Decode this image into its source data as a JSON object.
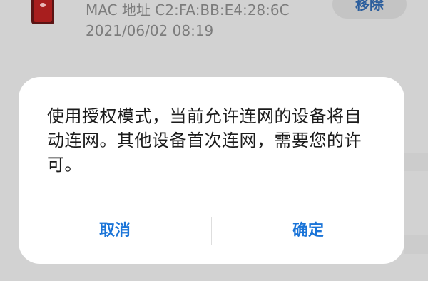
{
  "background": {
    "device_item": {
      "icon": "huawei-phone-icon",
      "mac_line": "MAC 地址 C2:FA:BB:E4:28:6C",
      "time_line": "2021/06/02 08:19",
      "remove_button": "移除"
    }
  },
  "dialog": {
    "message": "使用授权模式，当前允许连网的设备将自动连网。其他设备首次连网，需要您的许可。",
    "cancel_label": "取消",
    "confirm_label": "确定"
  },
  "colors": {
    "scrim": "#d2d2d2",
    "dialog_bg": "#ffffff",
    "accent": "#1a74d8",
    "secondary_text": "#7c7c7c"
  }
}
